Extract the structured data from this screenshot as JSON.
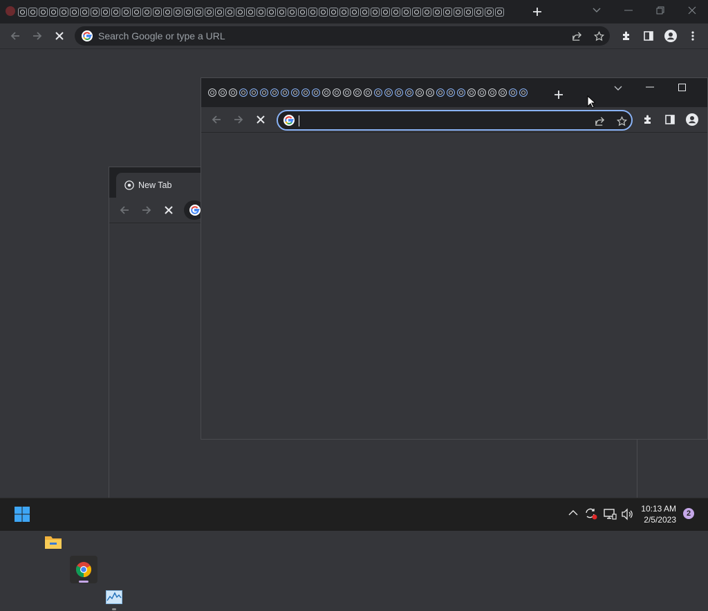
{
  "main_window": {
    "tab_count": 47,
    "omnibox": {
      "placeholder": "Search Google or type a URL"
    },
    "icons": [
      "back-icon",
      "forward-icon",
      "stop-icon",
      "google-icon",
      "share-icon",
      "star-icon",
      "extensions-icon",
      "side-panel-icon",
      "profile-icon",
      "kebab-menu-icon",
      "new-tab-icon",
      "tab-search-icon",
      "minimize-icon",
      "restore-icon",
      "close-icon"
    ]
  },
  "background_window": {
    "tab": {
      "title": "New Tab"
    }
  },
  "front_window": {
    "tab_count": 31,
    "blue_tab_indices": [
      3,
      4,
      5,
      6,
      7,
      8,
      9,
      10,
      16,
      17,
      18,
      19,
      22,
      23,
      24,
      29,
      30
    ],
    "omnibox": {
      "value": ""
    }
  },
  "taskbar": {
    "apps": [
      "start-button",
      "file-explorer",
      "chrome",
      "task-manager"
    ],
    "clock": {
      "time": "10:13 AM",
      "date": "2/5/2023"
    },
    "notifications": {
      "count": "2"
    }
  },
  "colors": {
    "accent_blue": "#8ab4f8",
    "background": "#35363a",
    "tabstrip": "#202124"
  }
}
